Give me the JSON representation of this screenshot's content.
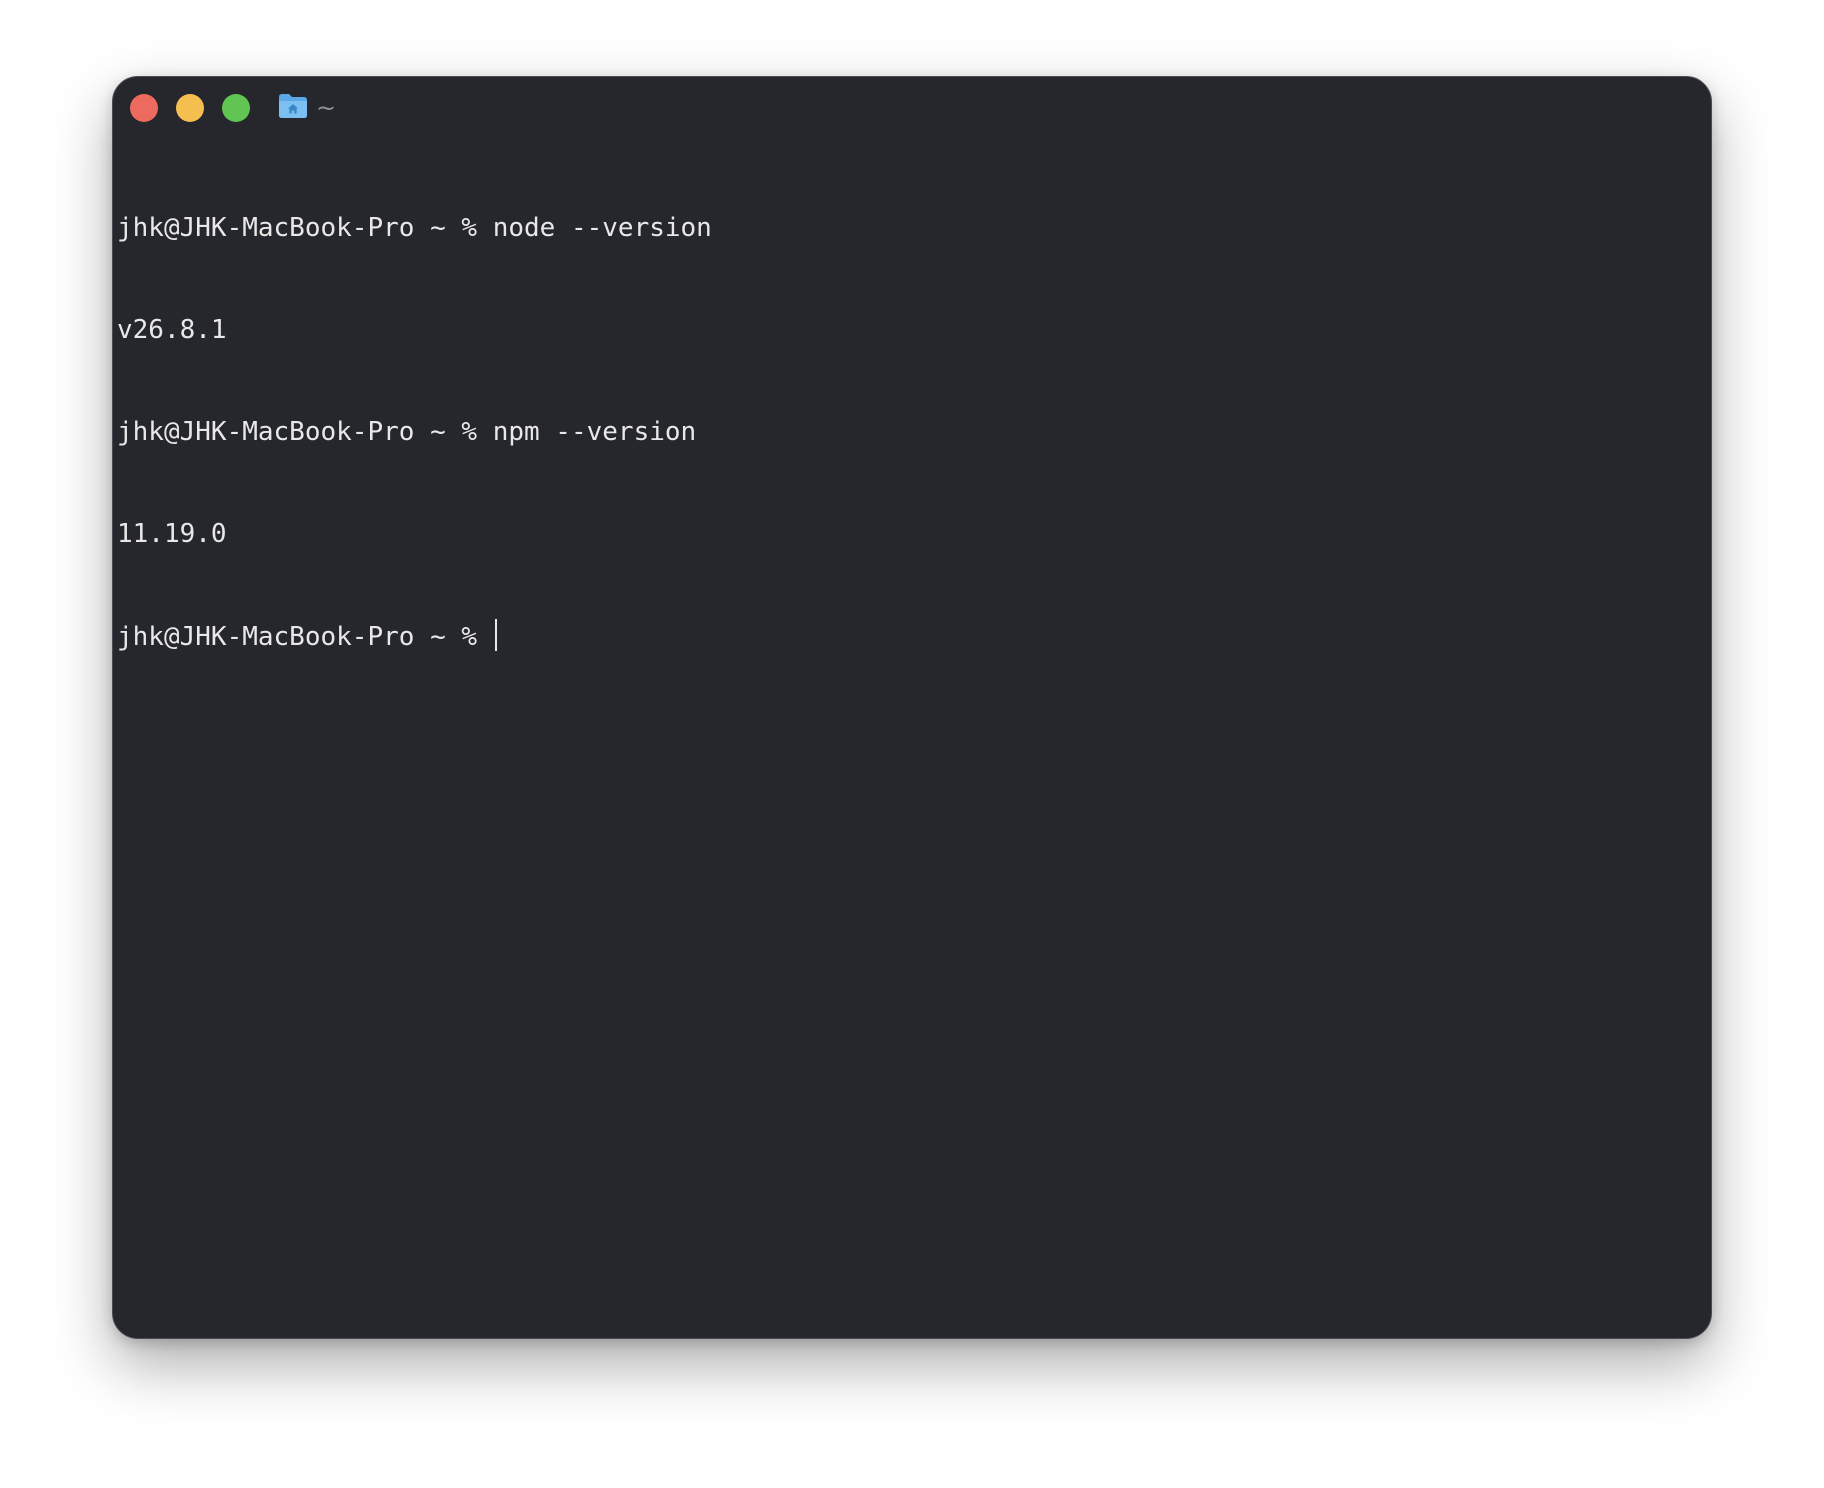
{
  "window": {
    "title": "~",
    "folder_icon": "home-folder-icon",
    "colors": {
      "background": "#25272c",
      "close": "#ed6a5e",
      "minimize": "#f4bf4f",
      "zoom": "#61c554",
      "text": "#e8e8e8"
    }
  },
  "terminal": {
    "lines": [
      {
        "prompt": "jhk@JHK-MacBook-Pro ~ % ",
        "text": "node --version"
      },
      {
        "prompt": "",
        "text": "v26.8.1"
      },
      {
        "prompt": "jhk@JHK-MacBook-Pro ~ % ",
        "text": "npm --version"
      },
      {
        "prompt": "",
        "text": "11.19.0"
      },
      {
        "prompt": "jhk@JHK-MacBook-Pro ~ % ",
        "text": ""
      }
    ]
  }
}
